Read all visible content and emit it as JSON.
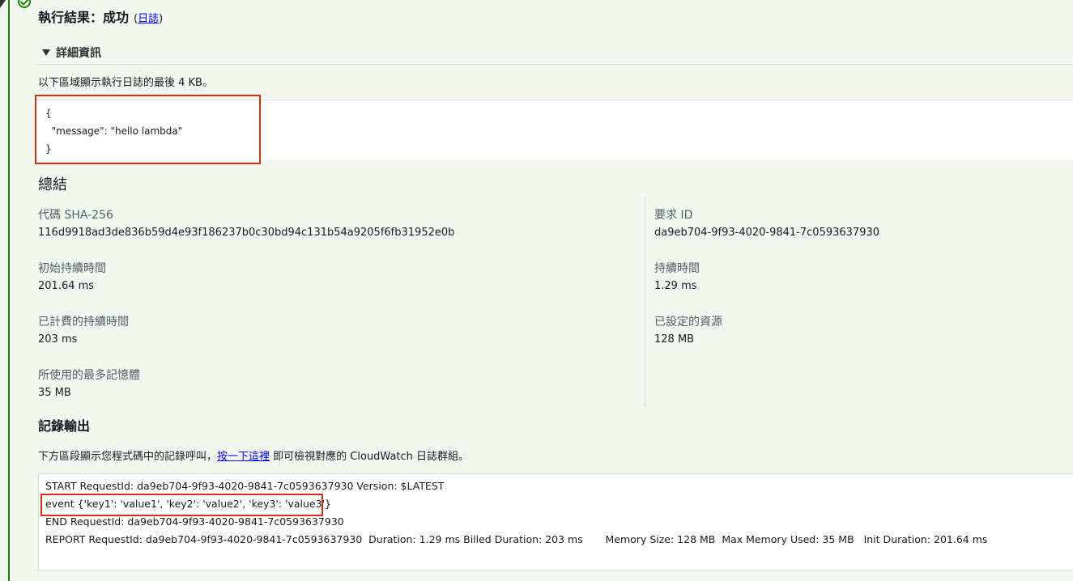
{
  "header": {
    "title": "執行結果：成功",
    "log_link_open": "(",
    "log_link": "日誌",
    "log_link_close": ")"
  },
  "details": {
    "toggle_label": "詳細資訊",
    "description": "以下區域顯示執行日誌的最後 4 KB。",
    "result_lines": [
      "{",
      "  \"message\": \"hello lambda\"",
      "}"
    ]
  },
  "summary": {
    "title": "總結",
    "fields": [
      {
        "label": "代碼 SHA-256",
        "value": "116d9918ad3de836b59d4e93f186237b0c30bd94c131b54a9205f6fb31952e0b"
      },
      {
        "label": "要求 ID",
        "value": "da9eb704-9f93-4020-9841-7c0593637930"
      },
      {
        "label": "初始持續時間",
        "value": "201.64 ms"
      },
      {
        "label": "持續時間",
        "value": "1.29 ms"
      },
      {
        "label": "已計費的持續時間",
        "value": "203 ms"
      },
      {
        "label": "已設定的資源",
        "value": "128 MB"
      },
      {
        "label": "所使用的最多記憶體",
        "value": "35 MB"
      }
    ]
  },
  "logs": {
    "title": "記錄輸出",
    "desc_before": "下方區段顯示您程式碼中的記錄呼叫，",
    "desc_link": "按一下這裡",
    "desc_after": " 即可檢視對應的 CloudWatch 日誌群組。",
    "lines": [
      "START RequestId: da9eb704-9f93-4020-9841-7c0593637930 Version: $LATEST",
      "event {'key1': 'value1', 'key2': 'value2', 'key3': 'value3'}",
      "END RequestId: da9eb704-9f93-4020-9841-7c0593637930",
      "REPORT RequestId: da9eb704-9f93-4020-9841-7c0593637930  Duration: 1.29 ms Billed Duration: 203 ms       Memory Size: 128 MB  Max Memory Used: 35 MB   Init Duration: 201.64 ms"
    ]
  },
  "colors": {
    "success": "#1d8102",
    "highlight": "#d13212",
    "link": "#0000ee"
  },
  "icons": {
    "status": "check-circle-icon",
    "toggle": "caret-down-icon"
  }
}
